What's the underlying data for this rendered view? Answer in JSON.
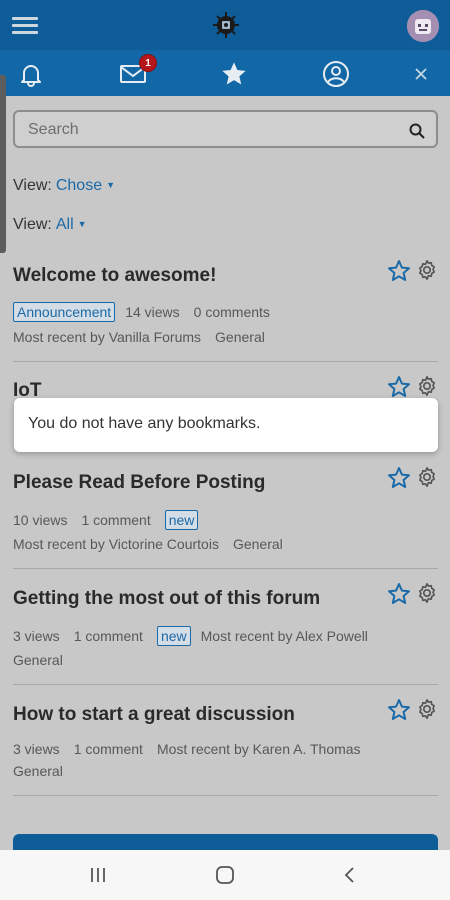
{
  "header": {
    "colors": {
      "primary": "#0f5d98",
      "secondary": "#1267a6",
      "link": "#1b6aa8"
    }
  },
  "iconbar": {
    "icons": [
      "bell-icon",
      "mail-icon",
      "star-icon",
      "user-circle-icon",
      "close-icon"
    ],
    "mail_badge": "1"
  },
  "search": {
    "placeholder": "Search"
  },
  "filters": [
    {
      "label": "View:",
      "value": "Chose"
    },
    {
      "label": "View:",
      "value": "All"
    }
  ],
  "discussions": [
    {
      "title": "Welcome to awesome!",
      "tag": "Announcement",
      "views": "14 views",
      "comments": "0 comments",
      "recent": "Most recent by Vanilla Forums",
      "category": "General"
    },
    {
      "title": "IoT"
    },
    {
      "title": "Please Read Before Posting",
      "views": "10 views",
      "comments": "1 comment",
      "tag": "new",
      "recent": "Most recent by Victorine Courtois",
      "category": "General"
    },
    {
      "title": "Getting the most out of this forum",
      "views": "3 views",
      "comments": "1 comment",
      "tag": "new",
      "recent": "Most recent by Alex Powell",
      "category": "General"
    },
    {
      "title": "How to start a great discussion",
      "views": "3 views",
      "comments": "1 comment",
      "recent": "Most recent by Karen A. Thomas",
      "category": "General"
    }
  ],
  "toast": {
    "message": "You do not have any bookmarks."
  },
  "navbar": {
    "icons": [
      "recent-apps-icon",
      "home-icon",
      "back-icon"
    ]
  }
}
